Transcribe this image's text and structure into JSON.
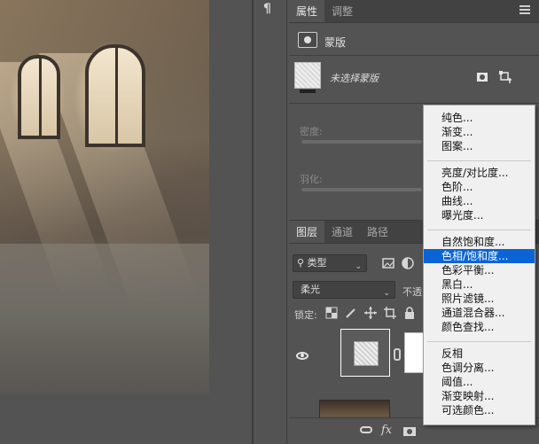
{
  "properties_panel": {
    "tabs": [
      {
        "label": "属性",
        "active": true
      },
      {
        "label": "调整",
        "active": false
      }
    ],
    "title": "蒙版",
    "no_mask_text": "未选择蒙版",
    "density_label": "密度:",
    "feather_label": "羽化:"
  },
  "layers_panel": {
    "tabs": [
      {
        "label": "图层",
        "active": true
      },
      {
        "label": "通道",
        "active": false
      },
      {
        "label": "路径",
        "active": false
      }
    ],
    "filter_kind": "类型",
    "blend_mode": "柔光",
    "opacity_label": "不透",
    "lock_label": "锁定:",
    "fx_label": "fx"
  },
  "context_menu": {
    "groups": [
      [
        "纯色...",
        "渐变...",
        "图案..."
      ],
      [
        "亮度/对比度...",
        "色阶...",
        "曲线...",
        "曝光度..."
      ],
      [
        "自然饱和度...",
        "色相/饱和度...",
        "色彩平衡...",
        "黑白...",
        "照片滤镜...",
        "通道混合器...",
        "颜色查找..."
      ],
      [
        "反相",
        "色调分离...",
        "阈值...",
        "渐变映射...",
        "可选颜色..."
      ]
    ],
    "highlighted": "色相/饱和度..."
  },
  "colors": {
    "panel_bg": "#535353",
    "tab_bar_bg": "#424242",
    "menu_bg": "#f0f0f0",
    "menu_highlight": "#0a64d6"
  }
}
